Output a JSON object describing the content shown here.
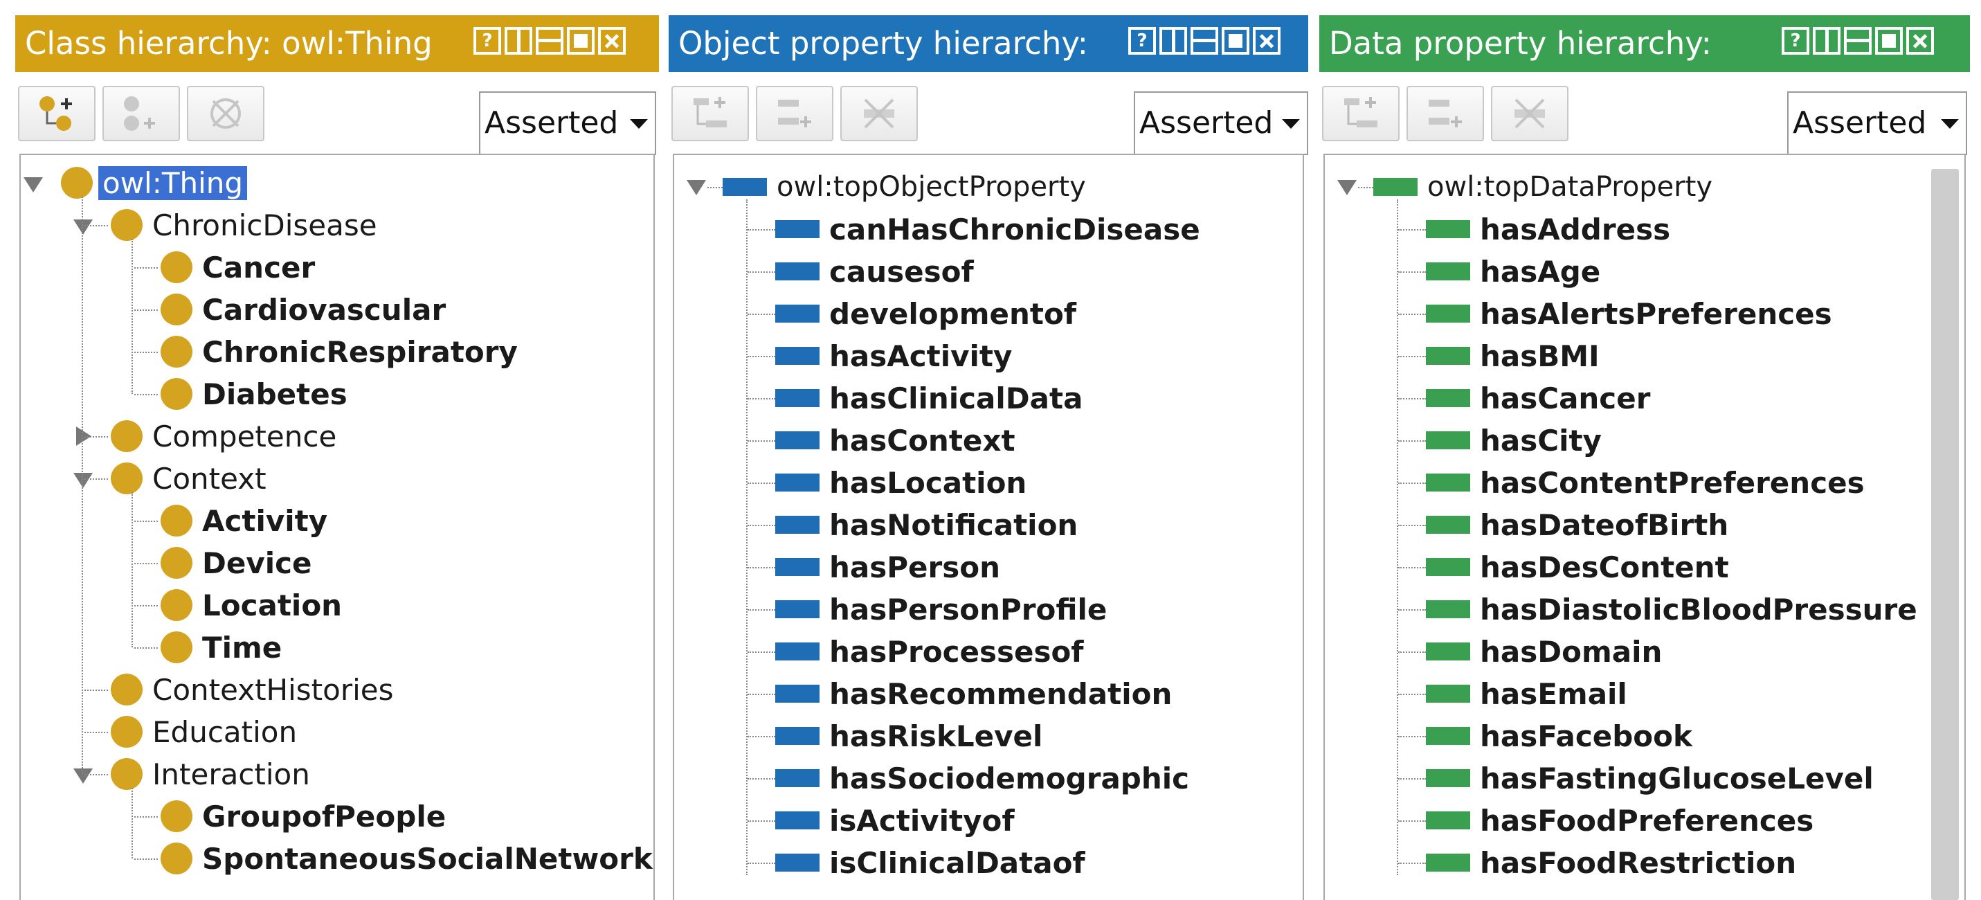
{
  "class_panel": {
    "title": "Class hierarchy: owl:Thing",
    "title_color": "#d4a014",
    "mode": "Asserted",
    "tree": [
      {
        "label": "owl:Thing",
        "level": 0,
        "expander": "down",
        "bold": false,
        "selected": true
      },
      {
        "label": "ChronicDisease",
        "level": 1,
        "expander": "down",
        "bold": false
      },
      {
        "label": "Cancer",
        "level": 2,
        "expander": "none",
        "bold": true
      },
      {
        "label": "Cardiovascular",
        "level": 2,
        "expander": "none",
        "bold": true
      },
      {
        "label": "ChronicRespiratory",
        "level": 2,
        "expander": "none",
        "bold": true
      },
      {
        "label": "Diabetes",
        "level": 2,
        "expander": "none",
        "bold": true
      },
      {
        "label": "Competence",
        "level": 1,
        "expander": "right",
        "bold": false
      },
      {
        "label": "Context",
        "level": 1,
        "expander": "down",
        "bold": false
      },
      {
        "label": "Activity",
        "level": 2,
        "expander": "none",
        "bold": true
      },
      {
        "label": "Device",
        "level": 2,
        "expander": "none",
        "bold": true
      },
      {
        "label": "Location",
        "level": 2,
        "expander": "none",
        "bold": true
      },
      {
        "label": "Time",
        "level": 2,
        "expander": "none",
        "bold": true
      },
      {
        "label": "ContextHistories",
        "level": 1,
        "expander": "none",
        "bold": false
      },
      {
        "label": "Education",
        "level": 1,
        "expander": "none",
        "bold": false
      },
      {
        "label": "Interaction",
        "level": 1,
        "expander": "down",
        "bold": false
      },
      {
        "label": "GroupofPeople",
        "level": 2,
        "expander": "none",
        "bold": true
      },
      {
        "label": "SpontaneousSocialNetwork",
        "level": 2,
        "expander": "none",
        "bold": true
      }
    ]
  },
  "object_panel": {
    "title": "Object property hierarchy:",
    "title_color": "#1f73b8",
    "mode": "Asserted",
    "root": "owl:topObjectProperty",
    "items": [
      "canHasChronicDisease",
      "causesof",
      "developmentof",
      "hasActivity",
      "hasClinicalData",
      "hasContext",
      "hasLocation",
      "hasNotification",
      "hasPerson",
      "hasPersonProfile",
      "hasProcessesof",
      "hasRecommendation",
      "hasRiskLevel",
      "hasSociodemographic",
      "isActivityof",
      "isClinicalDataof"
    ]
  },
  "data_panel": {
    "title": "Data property hierarchy:",
    "title_color": "#3aa153",
    "mode": "Asserted",
    "root": "owl:topDataProperty",
    "items": [
      "hasAddress",
      "hasAge",
      "hasAlertsPreferences",
      "hasBMI",
      "hasCancer",
      "hasCity",
      "hasContentPreferences",
      "hasDateofBirth",
      "hasDesContent",
      "hasDiastolicBloodPressure",
      "hasDomain",
      "hasEmail",
      "hasFacebook",
      "hasFastingGlucoseLevel",
      "hasFoodPreferences",
      "hasFoodRestriction"
    ]
  },
  "title_buttons": {
    "help": "?"
  },
  "icons": [
    "add-subclass-icon",
    "add-sibling-icon",
    "delete-icon",
    "help-icon",
    "split-vertical-icon",
    "split-horizontal-icon",
    "maximize-icon",
    "close-icon"
  ]
}
